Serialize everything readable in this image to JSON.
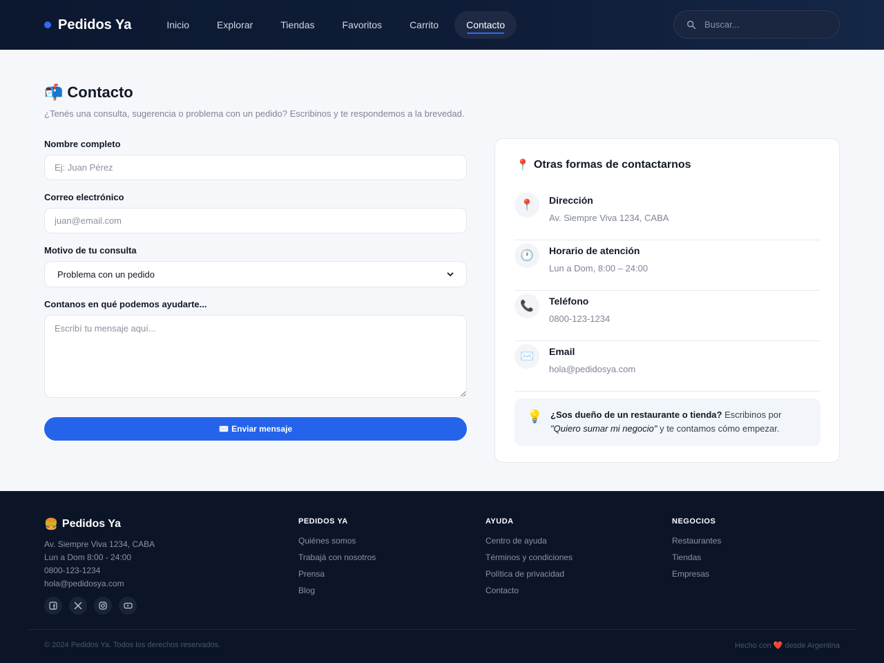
{
  "header": {
    "brand": "Pedidos Ya",
    "nav": [
      {
        "label": "Inicio"
      },
      {
        "label": "Explorar"
      },
      {
        "label": "Tiendas"
      },
      {
        "label": "Favoritos"
      },
      {
        "label": "Carrito"
      },
      {
        "label": "Contacto",
        "active": true
      }
    ],
    "search_placeholder": "Buscar..."
  },
  "page": {
    "title_emoji": "📬",
    "title": "Contacto",
    "subtitle": "¿Tenés una consulta, sugerencia o problema con un pedido? Escribinos y te respondemos a la brevedad."
  },
  "form": {
    "name_label": "Nombre completo",
    "name_placeholder": "Ej: Juan Pérez",
    "email_label": "Correo electrónico",
    "email_placeholder": "juan@email.com",
    "reason_label": "Motivo de tu consulta",
    "reason_value": "Problema con un pedido",
    "message_label": "Contanos en qué podemos ayudarte...",
    "message_placeholder": "Escribí tu mensaje aquí...",
    "submit_label": "✉️ Enviar mensaje"
  },
  "contact_card": {
    "title_emoji": "📍",
    "title": "Otras formas de contactarnos",
    "items": [
      {
        "icon": "📍",
        "icon_name": "pin-icon",
        "title": "Dirección",
        "value": "Av. Siempre Viva 1234, CABA"
      },
      {
        "icon": "🕐",
        "icon_name": "clock-icon",
        "title": "Horario de atención",
        "value": "Lun a Dom, 8:00 – 24:00"
      },
      {
        "icon": "📞",
        "icon_name": "phone-icon",
        "title": "Teléfono",
        "value": "0800-123-1234"
      },
      {
        "icon": "✉️",
        "icon_name": "envelope-icon",
        "title": "Email",
        "value": "hola@pedidosya.com"
      }
    ],
    "tip": {
      "icon": "💡",
      "bold": "¿Sos dueño de un restaurante o tienda?",
      "text1": " Escribinos por ",
      "italic": "\"Quiero sumar mi negocio\"",
      "text2": " y te contamos cómo empezar."
    }
  },
  "footer": {
    "brand_emoji": "🍔",
    "brand": "Pedidos Ya",
    "info": [
      "Av. Siempre Viva 1234, CABA",
      "Lun a Dom 8:00 - 24:00",
      "0800-123-1234",
      "hola@pedidosya.com"
    ],
    "columns": [
      {
        "title": "PEDIDOS YA",
        "links": [
          "Quiénes somos",
          "Trabajá con nosotros",
          "Prensa",
          "Blog"
        ]
      },
      {
        "title": "AYUDA",
        "links": [
          "Centro de ayuda",
          "Términos y condiciones",
          "Política de privacidad",
          "Contacto"
        ]
      },
      {
        "title": "NEGOCIOS",
        "links": [
          "Restaurantes",
          "Tiendas",
          "Empresas"
        ]
      }
    ],
    "copyright": "© 2024 Pedidos Ya. Todos los derechos reservados.",
    "made_with": "Hecho con ❤️ desde Argentina"
  },
  "colors": {
    "accent": "#2563eb",
    "header_bg": "#0f1d38",
    "footer_bg": "#0b1527"
  }
}
